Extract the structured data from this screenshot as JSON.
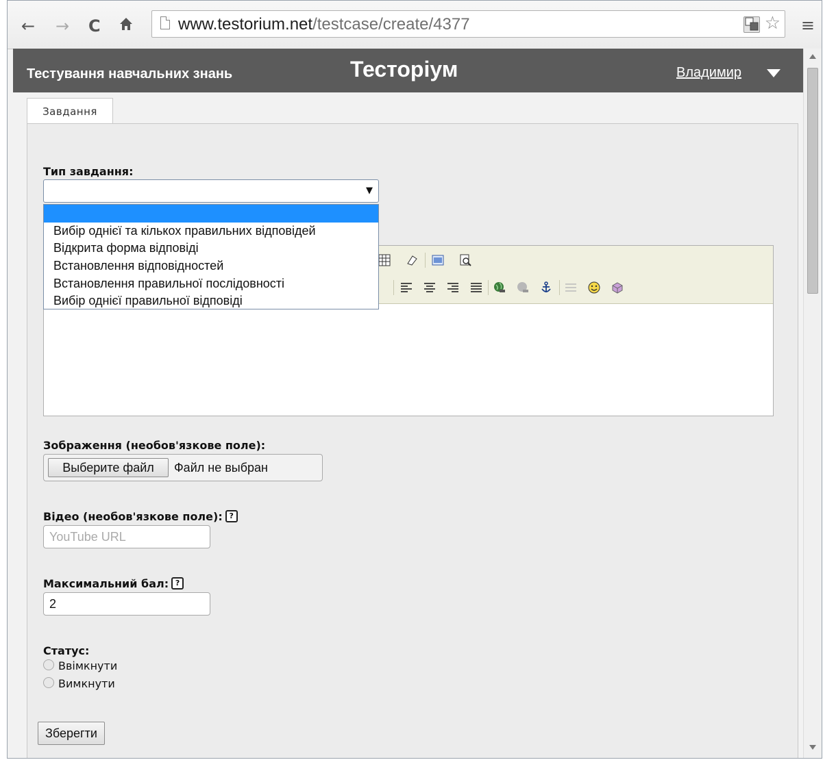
{
  "browser": {
    "url_host": "www.testorium.net",
    "url_path": "/testcase/create/4377"
  },
  "header": {
    "tagline": "Тестування навчальних знань",
    "title": "Тесторіум",
    "user": "Владимир"
  },
  "tabs": [
    {
      "label": "Завдання"
    }
  ],
  "form": {
    "type_label": "Тип завдання:",
    "type_options": [
      "",
      "Вибір однієї та кількох правильних відповідей",
      "Відкрита форма відповіді",
      "Встановлення відповідностей",
      "Встановлення правильної послідовності",
      "Вибір однієї правильної відповіді"
    ],
    "image_label": "Зображення (необов'язкове поле):",
    "file_button": "Выберите файл",
    "file_status": "Файл не выбран",
    "video_label": "Відео (необов'язкове поле):",
    "video_placeholder": "YouTube URL",
    "max_score_label": "Максимальний бал:",
    "max_score_value": "2",
    "status_label": "Статус:",
    "status_on": "Ввімкнути",
    "status_off": "Вимкнути",
    "save_button": "Зберегти",
    "help_glyph": "?"
  }
}
